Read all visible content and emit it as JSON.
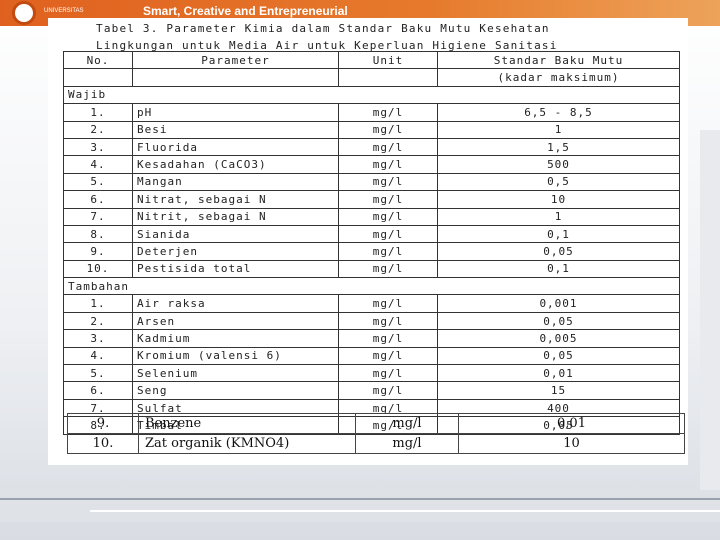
{
  "header": {
    "tagline": "Smart, Creative and Entrepreneurial",
    "logo_text": "UNIVERSITAS"
  },
  "document": {
    "title_line1": "Tabel 3. Parameter Kimia dalam Standar Baku Mutu Kesehatan",
    "title_line2": "Lingkungan untuk Media Air untuk Keperluan Higiene Sanitasi"
  },
  "table": {
    "columns": [
      "No.",
      "Parameter",
      "Unit",
      "Standar Baku Mutu"
    ],
    "standard_sub": "(kadar maksimum)",
    "sections": [
      {
        "label": "Wajib",
        "rows": [
          [
            "1.",
            "pH",
            "mg/l",
            "6,5 - 8,5"
          ],
          [
            "2.",
            "Besi",
            "mg/l",
            "1"
          ],
          [
            "3.",
            "Fluorida",
            "mg/l",
            "1,5"
          ],
          [
            "4.",
            "Kesadahan (CaCO3)",
            "mg/l",
            "500"
          ],
          [
            "5.",
            "Mangan",
            "mg/l",
            "0,5"
          ],
          [
            "6.",
            "Nitrat, sebagai N",
            "mg/l",
            "10"
          ],
          [
            "7.",
            "Nitrit, sebagai N",
            "mg/l",
            "1"
          ],
          [
            "8.",
            "Sianida",
            "mg/l",
            "0,1"
          ],
          [
            "9.",
            "Deterjen",
            "mg/l",
            "0,05"
          ],
          [
            "10.",
            "Pestisida total",
            "mg/l",
            "0,1"
          ]
        ]
      },
      {
        "label": "Tambahan",
        "rows": [
          [
            "1.",
            "Air raksa",
            "mg/l",
            "0,001"
          ],
          [
            "2.",
            "Arsen",
            "mg/l",
            "0,05"
          ],
          [
            "3.",
            "Kadmium",
            "mg/l",
            "0,005"
          ],
          [
            "4.",
            "Kromium (valensi 6)",
            "mg/l",
            "0,05"
          ],
          [
            "5.",
            "Selenium",
            "mg/l",
            "0,01"
          ],
          [
            "6.",
            "Seng",
            "mg/l",
            "15"
          ],
          [
            "7.",
            "Sulfat",
            "mg/l",
            "400"
          ],
          [
            "8.",
            "Timbal",
            "mg/l",
            "0,05"
          ]
        ]
      }
    ],
    "extra_rows": [
      [
        "9.",
        "Benzene",
        "mg/l",
        "0,01"
      ],
      [
        "10.",
        "Zat organik (KMNO4)",
        "mg/l",
        "10"
      ]
    ]
  }
}
